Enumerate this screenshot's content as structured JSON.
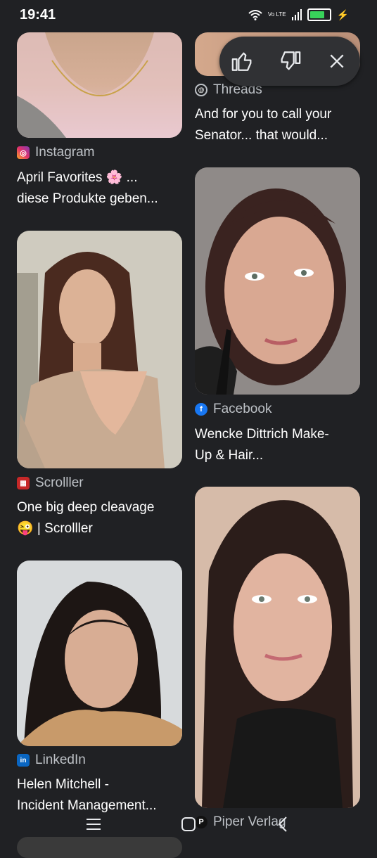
{
  "status": {
    "time": "19:41",
    "volte": "Vo LTE",
    "battery_level": 0.8
  },
  "feedback": {
    "like": "thumbs-up-icon",
    "dislike": "thumbs-down-icon",
    "close": "close-icon"
  },
  "results": [
    {
      "source": "Instagram",
      "title_line1": "April Favorites 🌸 ...",
      "title_line2": "diese Produkte geben..."
    },
    {
      "source": "Threads",
      "title_line1": "And for you to call your",
      "title_line2": "Senator... that would..."
    },
    {
      "source": "Facebook",
      "title_line1": "Wencke Dittrich Make-",
      "title_line2": "Up & Hair..."
    },
    {
      "source": "Scrolller",
      "title_line1": "One big deep cleavage",
      "title_line2": "😜 | Scrolller"
    },
    {
      "source": "LinkedIn",
      "title_line1": "Helen Mitchell -",
      "title_line2": "Incident Management..."
    },
    {
      "source": "Piper Verlag",
      "title_line1": "",
      "title_line2": ""
    }
  ],
  "nav": {
    "recent": "menu-icon",
    "home": "home-icon",
    "back": "back-icon"
  }
}
